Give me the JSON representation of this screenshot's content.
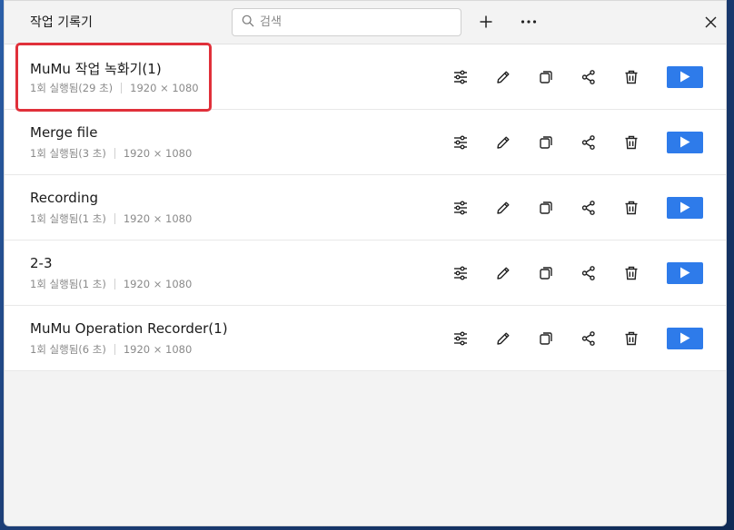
{
  "window": {
    "title": "작업 기록기",
    "search_placeholder": "검색"
  },
  "toolbar": {
    "add_icon": "plus-icon",
    "more_icon": "more-horizontal-icon",
    "close_icon": "close-icon"
  },
  "recordings": [
    {
      "name": "MuMu 작업 녹화기(1)",
      "runs": "1회 실행됨(29 초)",
      "resolution": "1920 × 1080"
    },
    {
      "name": "Merge file",
      "runs": "1회 실행됨(3 초)",
      "resolution": "1920 × 1080"
    },
    {
      "name": "Recording",
      "runs": "1회 실행됨(1 초)",
      "resolution": "1920 × 1080"
    },
    {
      "name": "2-3",
      "runs": "1회 실행됨(1 초)",
      "resolution": "1920 × 1080"
    },
    {
      "name": "MuMu Operation Recorder(1)",
      "runs": "1회 실행됨(6 초)",
      "resolution": "1920 × 1080"
    }
  ],
  "row_actions": [
    "settings-sliders-icon",
    "edit-pencil-icon",
    "copy-icon",
    "share-icon",
    "delete-trash-icon",
    "play-icon"
  ],
  "colors": {
    "play_button": "#2e7bea",
    "highlight_border": "#e0303a"
  }
}
